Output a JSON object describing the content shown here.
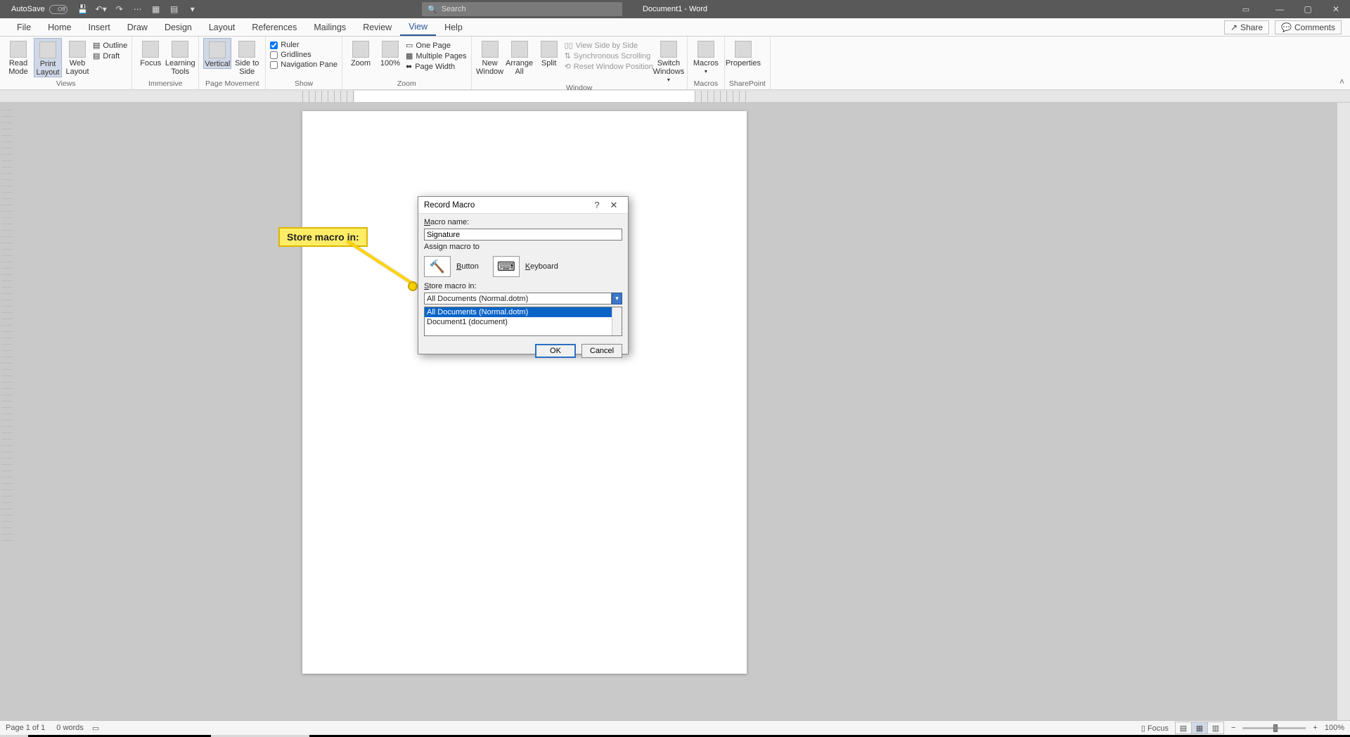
{
  "titlebar": {
    "autosave_label": "AutoSave",
    "autosave_state": "Off",
    "doc_title": "Document1 - Word",
    "search_placeholder": "Search"
  },
  "menu": {
    "tabs": [
      "File",
      "Home",
      "Insert",
      "Draw",
      "Design",
      "Layout",
      "References",
      "Mailings",
      "Review",
      "View",
      "Help"
    ],
    "active_index": 9,
    "share": "Share",
    "comments": "Comments"
  },
  "ribbon": {
    "views": {
      "read_mode": "Read Mode",
      "print_layout": "Print Layout",
      "web_layout": "Web Layout",
      "outline": "Outline",
      "draft": "Draft",
      "group": "Views"
    },
    "immersive": {
      "focus": "Focus",
      "learning_tools": "Learning Tools",
      "group": "Immersive"
    },
    "page_movement": {
      "vertical": "Vertical",
      "side_to_side": "Side to Side",
      "group": "Page Movement"
    },
    "show": {
      "ruler": "Ruler",
      "gridlines": "Gridlines",
      "nav_pane": "Navigation Pane",
      "group": "Show"
    },
    "zoom": {
      "zoom": "Zoom",
      "hundred": "100%",
      "one_page": "One Page",
      "multiple_pages": "Multiple Pages",
      "page_width": "Page Width",
      "group": "Zoom"
    },
    "window": {
      "new_window": "New Window",
      "arrange_all": "Arrange All",
      "split": "Split",
      "side_by_side": "View Side by Side",
      "sync_scroll": "Synchronous Scrolling",
      "reset_pos": "Reset Window Position",
      "switch": "Switch Windows",
      "group": "Window"
    },
    "macros": {
      "macros": "Macros",
      "group": "Macros"
    },
    "sharepoint": {
      "properties": "Properties",
      "group": "SharePoint"
    }
  },
  "callout": {
    "text": "Store macro in:"
  },
  "dialog": {
    "title": "Record Macro",
    "macro_name_label": "Macro name:",
    "macro_name_value": "Signature",
    "assign_label": "Assign macro to",
    "button_label": "Button",
    "keyboard_label": "Keyboard",
    "store_label": "Store macro in:",
    "combo_value": "All Documents (Normal.dotm)",
    "options": [
      "All Documents (Normal.dotm)",
      "Document1 (document)"
    ],
    "ok": "OK",
    "cancel": "Cancel"
  },
  "statusbar": {
    "page": "Page 1 of 1",
    "words": "0 words",
    "focus": "Focus",
    "zoom": "100%"
  }
}
